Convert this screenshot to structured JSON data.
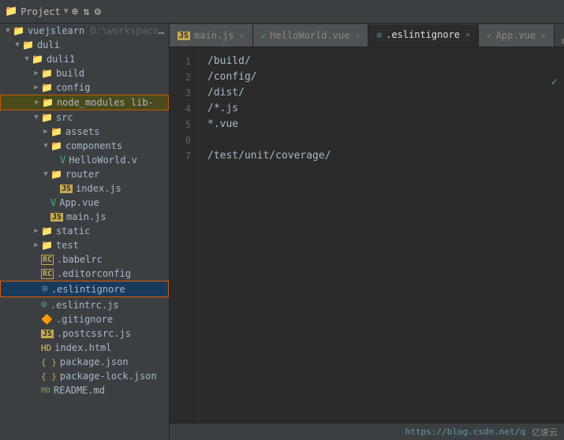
{
  "topbar": {
    "folder_icon": "📁",
    "project_label": "Project",
    "dropdown_arrow": "▼",
    "actions": [
      "⊕",
      "⇅",
      "⚙"
    ]
  },
  "tabs": [
    {
      "id": "main-js",
      "label": "main.js",
      "icon_type": "js",
      "active": false,
      "modified": false
    },
    {
      "id": "helloworld-vue",
      "label": "HelloWorld.vue",
      "icon_type": "vue",
      "active": false,
      "modified": true
    },
    {
      "id": "eslintignore",
      "label": ".eslintignore",
      "icon_type": "circle",
      "active": true,
      "modified": false
    },
    {
      "id": "app-vue",
      "label": "App.vue",
      "icon_type": "vue",
      "active": false,
      "modified": false
    }
  ],
  "sidebar": {
    "root_label": "vuejslearn",
    "root_path": "D:\\workspace\\W",
    "items": [
      {
        "id": "duli",
        "label": "duli",
        "type": "folder",
        "depth": 1,
        "open": true
      },
      {
        "id": "duli1",
        "label": "duli1",
        "type": "folder",
        "depth": 2,
        "open": true
      },
      {
        "id": "build",
        "label": "build",
        "type": "folder",
        "depth": 3,
        "open": false
      },
      {
        "id": "config",
        "label": "config",
        "type": "folder",
        "depth": 3,
        "open": false
      },
      {
        "id": "node_modules",
        "label": "node_modules  lib-",
        "type": "folder",
        "depth": 3,
        "open": false,
        "highlighted": true
      },
      {
        "id": "src",
        "label": "src",
        "type": "folder",
        "depth": 3,
        "open": true
      },
      {
        "id": "assets",
        "label": "assets",
        "type": "folder",
        "depth": 4,
        "open": false
      },
      {
        "id": "components",
        "label": "components",
        "type": "folder",
        "depth": 4,
        "open": true
      },
      {
        "id": "helloworld-file",
        "label": "HelloWorld.v",
        "type": "vue",
        "depth": 5
      },
      {
        "id": "router",
        "label": "router",
        "type": "folder",
        "depth": 4,
        "open": true
      },
      {
        "id": "index-js",
        "label": "index.js",
        "type": "js",
        "depth": 5
      },
      {
        "id": "app-vue-file",
        "label": "App.vue",
        "type": "vue",
        "depth": 4
      },
      {
        "id": "main-js-file",
        "label": "main.js",
        "type": "js",
        "depth": 4
      },
      {
        "id": "static",
        "label": "static",
        "type": "folder",
        "depth": 3,
        "open": false
      },
      {
        "id": "test",
        "label": "test",
        "type": "folder",
        "depth": 3,
        "open": false
      },
      {
        "id": "babelrc",
        "label": ".babelrc",
        "type": "rc",
        "depth": 3
      },
      {
        "id": "editorconfig",
        "label": ".editorconfig",
        "type": "rc",
        "depth": 3
      },
      {
        "id": "eslintignore-file",
        "label": ".eslintignore",
        "type": "circle",
        "depth": 3,
        "active": true
      },
      {
        "id": "eslintrc",
        "label": ".eslintrc.js",
        "type": "circle",
        "depth": 3
      },
      {
        "id": "gitignore",
        "label": ".gitignore",
        "type": "git",
        "depth": 3
      },
      {
        "id": "postcssrc",
        "label": ".postcssrc.js",
        "type": "js",
        "depth": 3
      },
      {
        "id": "index-html",
        "label": "index.html",
        "type": "html",
        "depth": 3
      },
      {
        "id": "package-json",
        "label": "package.json",
        "type": "json",
        "depth": 3
      },
      {
        "id": "package-lock",
        "label": "package-lock.json",
        "type": "json",
        "depth": 3
      },
      {
        "id": "readme",
        "label": "README.md",
        "type": "md",
        "depth": 3
      }
    ]
  },
  "editor": {
    "lines": [
      {
        "num": "1",
        "code": "/build/"
      },
      {
        "num": "2",
        "code": "/config/"
      },
      {
        "num": "3",
        "code": "/dist/"
      },
      {
        "num": "4",
        "code": "/*.js"
      },
      {
        "num": "5",
        "code": "*.vue",
        "highlighted": true
      },
      {
        "num": "6",
        "code": ""
      },
      {
        "num": "7",
        "code": "/test/unit/coverage/"
      }
    ]
  },
  "statusbar": {
    "url": "https://blog.csdn.net/q",
    "brand": "亿速云"
  },
  "checkmark": "✓"
}
